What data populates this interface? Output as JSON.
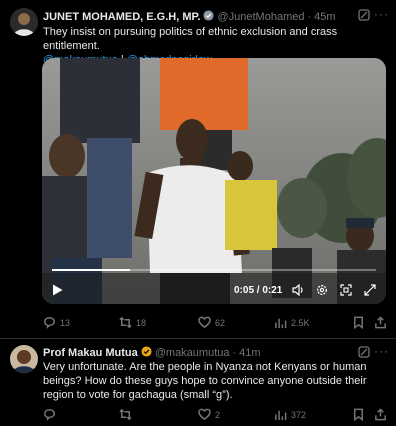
{
  "tweet1": {
    "name": "JUNET MOHAMED, E.G.H, MP.",
    "handle": "@JunetMohamed",
    "separator": "·",
    "time": "45m",
    "text": "They insist on pursuing politics of ethnic exclusion and crass entitlement.",
    "mention1": "@makaumutua",
    "mention_sep": "|",
    "mention2": "@ahmednasirlaw",
    "video": {
      "time": "0:05 / 0:21",
      "progress": 0.24
    },
    "actions": {
      "replies": "13",
      "reposts": "18",
      "likes": "62",
      "views": "2.5K"
    }
  },
  "tweet2": {
    "name": "Prof Makau Mutua",
    "handle": "@makaumutua",
    "separator": "·",
    "time": "41m",
    "text": "Very unfortunate.  Are the people in Nyanza not Kenyans or human beings? How do these guys hope to convince anyone outside their region to vote for gachagua (small “g”).",
    "actions": {
      "replies": "",
      "reposts": "",
      "likes": "2",
      "views": "372"
    }
  },
  "icons": [
    "grok-icon",
    "more-icon",
    "play-icon",
    "volume-icon",
    "settings-icon",
    "exit-fullscreen-icon",
    "fullscreen-icon",
    "reply-icon",
    "repost-icon",
    "like-icon",
    "views-icon",
    "bookmark-icon",
    "share-icon",
    "verified-badge-icon"
  ],
  "colors": {
    "background": "#000000",
    "accent": "#1d9bf0",
    "muted": "#71767b",
    "verified": "#e8a317"
  }
}
